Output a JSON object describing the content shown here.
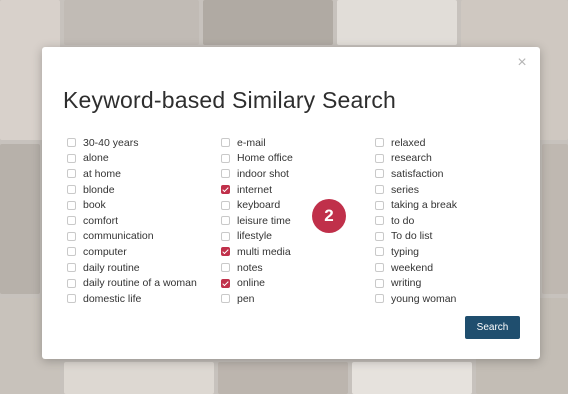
{
  "dialog": {
    "title": "Keyword-based Similary Search",
    "close_label": "×",
    "search_button_label": "Search"
  },
  "badge": {
    "text": "2",
    "color": "#c0304a"
  },
  "colors": {
    "accent": "#c0304a",
    "button": "#1f4e6e"
  },
  "keywords": {
    "col1": [
      {
        "label": "30-40 years",
        "checked": false
      },
      {
        "label": "alone",
        "checked": false
      },
      {
        "label": "at home",
        "checked": false
      },
      {
        "label": "blonde",
        "checked": false
      },
      {
        "label": "book",
        "checked": false
      },
      {
        "label": "comfort",
        "checked": false
      },
      {
        "label": "communication",
        "checked": false
      },
      {
        "label": "computer",
        "checked": false
      },
      {
        "label": "daily routine",
        "checked": false
      },
      {
        "label": "daily routine of a woman",
        "checked": false
      },
      {
        "label": "domestic life",
        "checked": false
      }
    ],
    "col2": [
      {
        "label": "e-mail",
        "checked": false
      },
      {
        "label": "Home office",
        "checked": false
      },
      {
        "label": "indoor shot",
        "checked": false
      },
      {
        "label": "internet",
        "checked": true
      },
      {
        "label": "keyboard",
        "checked": false
      },
      {
        "label": "leisure time",
        "checked": false
      },
      {
        "label": "lifestyle",
        "checked": false
      },
      {
        "label": "multi media",
        "checked": true
      },
      {
        "label": "notes",
        "checked": false
      },
      {
        "label": "online",
        "checked": true
      },
      {
        "label": "pen",
        "checked": false
      }
    ],
    "col3": [
      {
        "label": "relaxed",
        "checked": false
      },
      {
        "label": "research",
        "checked": false
      },
      {
        "label": "satisfaction",
        "checked": false
      },
      {
        "label": "series",
        "checked": false
      },
      {
        "label": "taking a break",
        "checked": false
      },
      {
        "label": "to do",
        "checked": false
      },
      {
        "label": "To do list",
        "checked": false
      },
      {
        "label": "typing",
        "checked": false
      },
      {
        "label": "weekend",
        "checked": false
      },
      {
        "label": "writing",
        "checked": false
      },
      {
        "label": "young woman",
        "checked": false
      }
    ]
  }
}
